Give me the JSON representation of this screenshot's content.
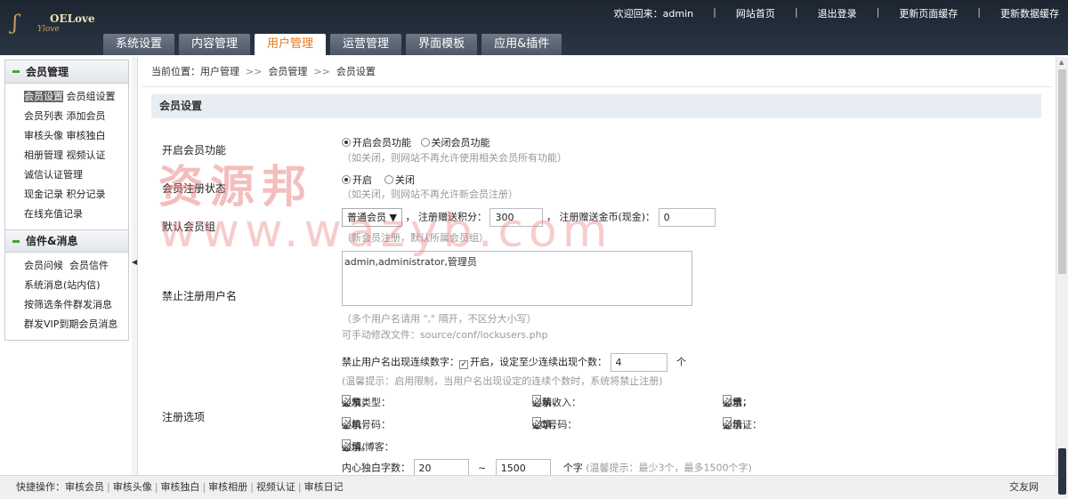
{
  "logo": {
    "mark": "ʃ",
    "text": "OELove",
    "sub": "Ylove"
  },
  "toplinks": {
    "welcome": "欢迎回来：admin",
    "home": "网站首页",
    "logout": "退出登录",
    "refresh_page": "更新页面缓存",
    "refresh_data": "更新数据缓存"
  },
  "nav": [
    "系统设置",
    "内容管理",
    "用户管理",
    "运营管理",
    "界面模板",
    "应用&插件"
  ],
  "sidebar": {
    "member_title": "会员管理",
    "member_items": [
      {
        "a": "会员设置",
        "b": "会员组设置"
      },
      {
        "a": "会员列表",
        "b": "添加会员"
      },
      {
        "a": "审核头像",
        "b": "审核独白"
      },
      {
        "a": "相册管理",
        "b": "视频认证"
      },
      {
        "a": "诚信认证管理",
        "b": ""
      },
      {
        "a": "现金记录",
        "b": "积分记录"
      },
      {
        "a": "在线充值记录",
        "b": ""
      }
    ],
    "msg_title": "信件&消息",
    "msg_items": [
      {
        "a": "会员问候",
        "b": "会员信件"
      },
      {
        "a": "系统消息(站内信)",
        "b": ""
      },
      {
        "a": "按筛选条件群发消息",
        "b": ""
      },
      {
        "a": "群发VIP到期会员消息",
        "b": ""
      }
    ]
  },
  "breadcrumb": {
    "prefix": "当前位置：",
    "c1": "用户管理",
    "c2": "会员管理",
    "c3": "会员设置",
    "sep": ">>"
  },
  "section_title": "会员设置",
  "form": {
    "enable_label": "开启会员功能",
    "enable_on": "开启会员功能",
    "enable_off": "关闭会员功能",
    "enable_hint": "（如关闭，则网站不再允许使用相关会员所有功能）",
    "reg_label": "会员注册状态",
    "reg_on": "开启",
    "reg_off": "关闭",
    "reg_hint": "（如关闭，则网站不再允许新会员注册）",
    "group_label": "默认会员组",
    "group_value": "普通会员 ▼",
    "points_label": "， 注册赠送积分：",
    "points_value": "300",
    "gold_label": "， 注册赠送金币(现金)：",
    "gold_value": "0",
    "group_hint": "（新会员注册，默认所属会员组）",
    "ban_label": "禁止注册用户名",
    "ban_value": "admin,administrator,管理员",
    "ban_hint1": "（多个用户名请用 \",\" 隔开，不区分大小写）",
    "ban_hint2": "可手动修改文件：source/conf/lockusers.php",
    "opt_label": "注册选项",
    "consecutive_label": "禁止用户名出现连续数字：",
    "consecutive_on": "开启，设定至少连续出现个数：",
    "consecutive_value": "4",
    "consecutive_unit": "个",
    "consecutive_hint": "(温馨提示：启用限制，当用户名出现设定的连续个数时，系统将禁止注册)",
    "show": "显示，",
    "required": "必填",
    "fields": [
      {
        "name": "交友类型："
      },
      {
        "name": "月薪收入："
      },
      {
        "name": "体重："
      },
      {
        "name": "手机号码："
      },
      {
        "name": "QQ号码："
      },
      {
        "name": "身份证："
      },
      {
        "name": "微博/博客："
      }
    ],
    "mono_label": "内心独白字数：",
    "mono_min": "20",
    "mono_tilde": "~",
    "mono_max": "1500",
    "mono_unit": "个字",
    "mono_hint": "(温馨提示：最少3个，最多1500个字)"
  },
  "watermark": {
    "line1": "资源邦",
    "line2": "www.wazyb.com"
  },
  "footer": {
    "prefix": "快捷操作：",
    "links": [
      "审核会员",
      "审核头像",
      "审核独白",
      "审核相册",
      "视频认证",
      "审核日记"
    ],
    "right": "交友网"
  }
}
